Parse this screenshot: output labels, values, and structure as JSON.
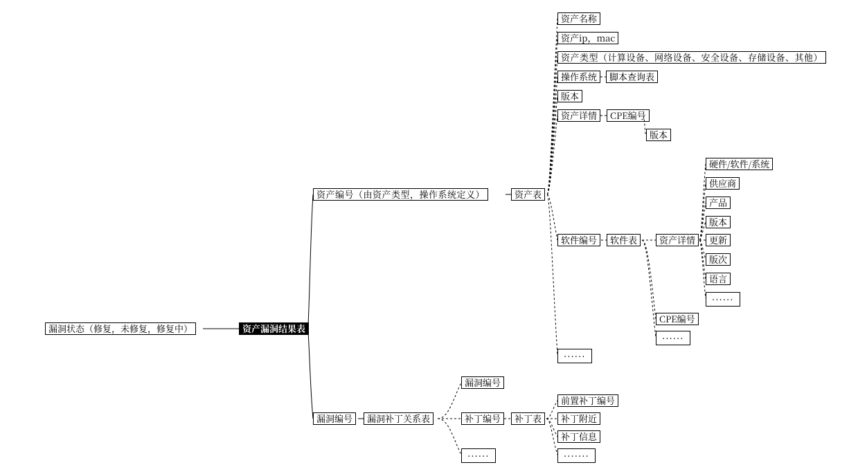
{
  "root_left": "漏洞状态（修复，未修复，修复中）",
  "root_center": "资产漏洞结果表",
  "asset_id": {
    "label": "资产编号（由资产类型，操作系统定义）",
    "table": "资产表",
    "children": {
      "name": "资产名称",
      "ip_mac": "资产ip，mac",
      "type": "资产类型（计算设备、网络设备、安全设备、存储设备、其他）",
      "os": "操作系统",
      "script_tbl": "脚本查询表",
      "version": "版本",
      "detail": "资产详情",
      "cpe": "CPE编号",
      "cpe_ver": "版本",
      "sw_id": "软件编号",
      "sw_tbl": "软件表",
      "sw_more": "......",
      "sw_detail": {
        "label": "资产详情",
        "hw_sw_sys": "硬件/软件/系统",
        "vendor": "供应商",
        "product": "产品",
        "version": "版本",
        "update": "更新",
        "edition": "版次",
        "language": "语言",
        "more": "......"
      },
      "sw_cpe": "CPE编号",
      "sw_cpe_more": "......"
    }
  },
  "vuln_id_solo": "漏洞编号",
  "vuln_patch": {
    "vuln_id": "漏洞编号",
    "rel_tbl": "漏洞补丁关系表",
    "patch_id": "补丁编号",
    "patch_tbl": "补丁表",
    "more": "......",
    "patch_children": {
      "pre_patch_id": "前置补丁编号",
      "patch_near": "补丁附近",
      "patch_info": "补丁信息",
      "more": "......."
    }
  }
}
